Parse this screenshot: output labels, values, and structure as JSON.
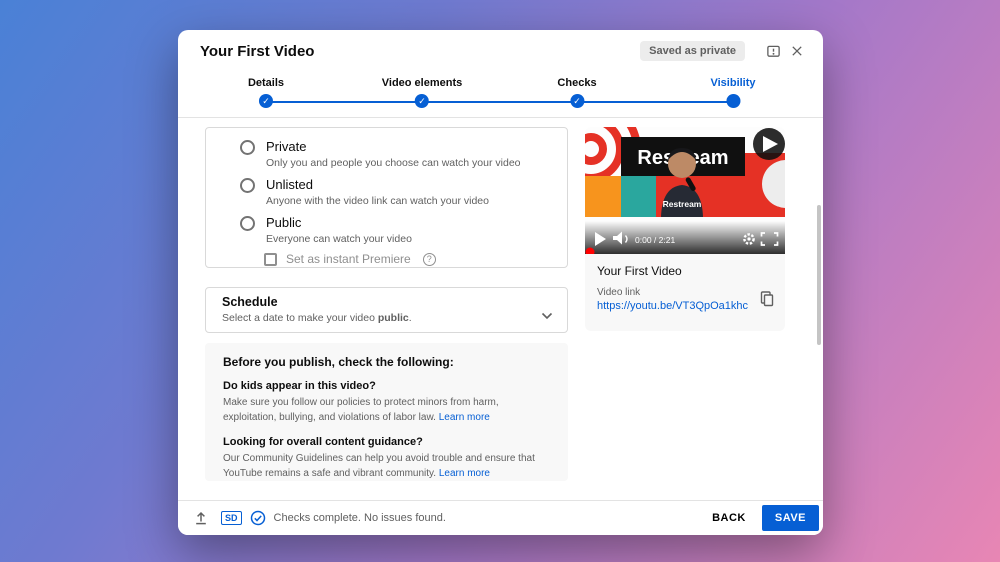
{
  "window": {
    "title": "Your First Video",
    "saved_badge": "Saved as private"
  },
  "stepper": {
    "steps": [
      {
        "label": "Details",
        "state": "complete"
      },
      {
        "label": "Video elements",
        "state": "complete"
      },
      {
        "label": "Checks",
        "state": "complete"
      },
      {
        "label": "Visibility",
        "state": "current"
      }
    ]
  },
  "visibility": {
    "options": [
      {
        "label": "Private",
        "description": "Only you and people you choose can watch your video",
        "selected": false
      },
      {
        "label": "Unlisted",
        "description": "Anyone with the video link can watch your video",
        "selected": false
      },
      {
        "label": "Public",
        "description": "Everyone can watch your video",
        "selected": false
      }
    ],
    "premiere": {
      "label": "Set as instant Premiere",
      "checked": false
    }
  },
  "schedule": {
    "title": "Schedule",
    "desc_prefix": "Select a date to make your video ",
    "desc_bold": "public",
    "desc_suffix": "."
  },
  "publish_checks": {
    "title": "Before you publish, check the following:",
    "items": [
      {
        "question": "Do kids appear in this video?",
        "body": "Make sure you follow our policies to protect minors from harm, exploitation, bullying, and violations of labor law.",
        "link": "Learn more"
      },
      {
        "question": "Looking for overall content guidance?",
        "body": "Our Community Guidelines can help you avoid trouble and ensure that YouTube remains a safe and vibrant community.",
        "link": "Learn more"
      }
    ]
  },
  "preview": {
    "brand": "Restream",
    "brand_small": "Restream",
    "time": "0:00 / 2:21",
    "video_title": "Your First Video",
    "link_label": "Video link",
    "link_url": "https://youtu.be/VT3QpOa1khc"
  },
  "footer": {
    "sd_badge": "SD",
    "status": "Checks complete. No issues found.",
    "back": "BACK",
    "save": "SAVE"
  },
  "icons": {
    "check": "✓",
    "help": "?"
  },
  "colors": {
    "accent": "#065fd4",
    "badge_bg": "#ececec",
    "thumb_red": "#e53125",
    "thumb_orange": "#f7941d",
    "thumb_teal": "#2aa79e"
  }
}
